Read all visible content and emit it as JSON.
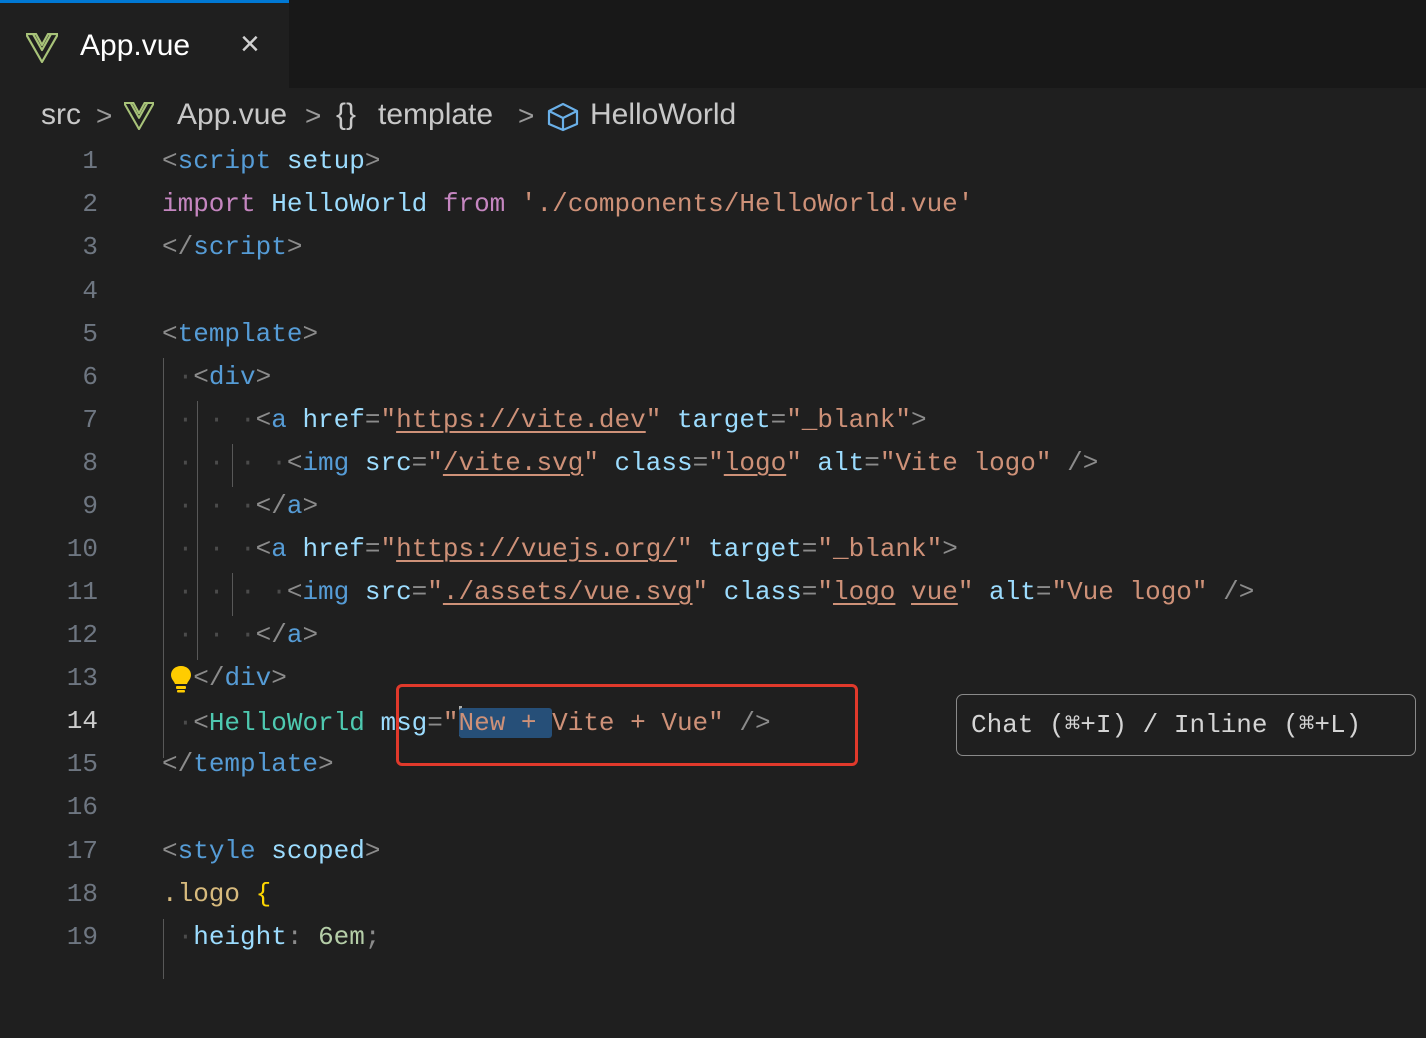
{
  "tab": {
    "title": "App.vue",
    "close_icon": "×",
    "active_border_color": "#0078d4"
  },
  "breadcrumb": {
    "items": [
      "src",
      "App.vue",
      "{}",
      "template",
      "HelloWorld"
    ],
    "separator": ">"
  },
  "editor": {
    "active_line": "14",
    "lines": [
      "1",
      "2",
      "3",
      "4",
      "5",
      "6",
      "7",
      "8",
      "9",
      "10",
      "11",
      "12",
      "13",
      "14",
      "15",
      "16",
      "17",
      "18",
      "19"
    ],
    "code": {
      "l1_tag": "script",
      "l1_attr": "setup",
      "l2_import": "import",
      "l2_name": "HelloWorld",
      "l2_from": "from",
      "l2_path": "'./components/HelloWorld.vue'",
      "l3_tag": "script",
      "l5_tag": "template",
      "l6_tag": "div",
      "l7_tag": "a",
      "l7_href": "href",
      "l7_url": "https://vite.dev",
      "l7_target": "target",
      "l7_blank": "_blank",
      "l8_tag": "img",
      "l8_src": "src",
      "l8_path": "/vite.svg",
      "l8_class": "class",
      "l8_cls": "logo",
      "l8_alt": "alt",
      "l8_altval": "Vite logo",
      "l9_tag": "a",
      "l10_tag": "a",
      "l10_href": "href",
      "l10_url": "https://vuejs.org/",
      "l10_target": "target",
      "l10_blank": "_blank",
      "l11_tag": "img",
      "l11_src": "src",
      "l11_path": "./assets/vue.svg",
      "l11_class": "class",
      "l11_cls1": "logo",
      "l11_cls2": "vue",
      "l11_alt": "alt",
      "l11_altval": "Vue logo",
      "l12_tag": "a",
      "l13_tag": "div",
      "l14_tag": "HelloWorld",
      "l14_attr": "msg",
      "l14_sel": "New + ",
      "l14_rest": "Vite + Vue",
      "l15_tag": "template",
      "l17_tag": "style",
      "l17_attr": "scoped",
      "l18_sel": ".logo",
      "l18_brace": "{",
      "l19_prop": "height",
      "l19_val": "6em"
    }
  },
  "inline_hint": {
    "text": "Chat (⌘+I) / Inline (⌘+L)"
  },
  "icons": {
    "tab": "vue-logo-icon",
    "lightbulb": "lightbulb-icon",
    "component": "cube-icon"
  },
  "colors": {
    "highlight_box": "#e0392b",
    "selection": "#264f78"
  }
}
